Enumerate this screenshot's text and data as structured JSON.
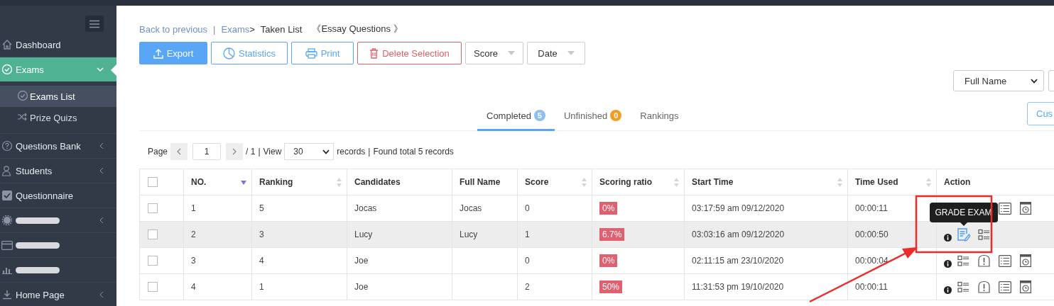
{
  "sidebar": {
    "items": [
      {
        "kind": "home",
        "label": "Dashboard",
        "redacted": false,
        "selected": false,
        "submenu": false
      },
      {
        "kind": "check",
        "label": "Exams",
        "redacted": false,
        "selected": true,
        "submenu": true,
        "expanded": true,
        "children": [
          {
            "kind": "check",
            "label": "Exams List",
            "selected": true
          },
          {
            "kind": "shuffle",
            "label": "Prize Quizs",
            "selected": false
          }
        ]
      },
      {
        "kind": "question",
        "label": "Questions Bank",
        "redacted": false,
        "selected": false,
        "submenu": true,
        "expanded": false
      },
      {
        "kind": "user",
        "label": "Students",
        "redacted": false,
        "selected": false,
        "submenu": true,
        "expanded": false
      },
      {
        "kind": "checkbox",
        "label": "Questionnaire",
        "redacted": false,
        "selected": false,
        "submenu": false
      },
      {
        "kind": "gear",
        "redacted": true,
        "selected": false,
        "submenu": true,
        "expanded": false
      },
      {
        "kind": "card",
        "redacted": true,
        "selected": false,
        "submenu": false
      },
      {
        "kind": "chart",
        "redacted": true,
        "selected": false,
        "submenu": false
      },
      {
        "kind": "download",
        "label": "Home Page",
        "redacted": false,
        "selected": false,
        "submenu": true,
        "expanded": false
      }
    ]
  },
  "breadcrumb": {
    "back": "Back to previous",
    "separator": "|",
    "parent": "Exams",
    "arrow": ">",
    "current": "Taken List",
    "subject": "《Essay Questions 》"
  },
  "toolbar": [
    {
      "kind": "export",
      "label": "Export"
    },
    {
      "kind": "statistics",
      "label": "Statistics"
    },
    {
      "kind": "print",
      "label": "Print"
    },
    {
      "kind": "delete",
      "label": "Delete Selection"
    },
    {
      "kind": "dropdown",
      "label": "Score"
    },
    {
      "kind": "dropdown",
      "label": "Date"
    }
  ],
  "search": {
    "field": "Full Name"
  },
  "tabs": [
    {
      "label": "Completed",
      "count": "5",
      "color": "#8cbff0",
      "selected": true
    },
    {
      "label": "Unfinished",
      "count": "0",
      "color": "#f39c1f",
      "selected": false
    },
    {
      "label": "Rankings",
      "selected": false
    }
  ],
  "custom_button": "Cus",
  "pagination": {
    "label": "Page",
    "page": "1",
    "total": "/ 1",
    "separator": "|",
    "view": "View",
    "per_page": "30",
    "records": "records",
    "separator_2": "|",
    "found": "Found total 5 records"
  },
  "table": {
    "select_all": false,
    "columns": [
      {
        "label": "NO.",
        "sortable": true,
        "sorted": true
      },
      {
        "label": "Ranking",
        "sortable": true,
        "sorted": false
      },
      {
        "label": "Candidates",
        "sortable": false
      },
      {
        "label": "Full Name",
        "sortable": false
      },
      {
        "label": "Score",
        "sortable": true,
        "sorted": false
      },
      {
        "label": "Scoring ratio",
        "sortable": true,
        "sorted": false
      },
      {
        "label": "Start Time",
        "sortable": true,
        "sorted": false
      },
      {
        "label": "Time Used",
        "sortable": true,
        "sorted": false
      },
      {
        "label": "Action"
      }
    ],
    "rows": [
      {
        "checked": false,
        "highlighted": false,
        "cells": [
          "1",
          "5",
          "Jocas",
          "Jocas",
          "0"
        ],
        "ratio": "0%",
        "start": "03:17:59 am 09/12/2020",
        "used": "00:00:11",
        "actions": [
          {
            "kind": "covered-info"
          },
          {
            "kind": "covered"
          },
          {
            "kind": "covered"
          },
          {
            "kind": "details",
            "active": false
          },
          {
            "kind": "clock-window",
            "active": false
          }
        ]
      },
      {
        "checked": false,
        "highlighted": true,
        "cells": [
          "2",
          "3",
          "Lucy",
          "Lucy",
          "1"
        ],
        "ratio": "6.7%",
        "start": "03:03:16 am 09/12/2020",
        "used": "00:00:50",
        "actions": [
          {
            "kind": "info"
          },
          {
            "kind": "grade",
            "active": true,
            "tooltip": "GRADE EXAM"
          },
          {
            "kind": "checklist",
            "active": false
          }
        ]
      },
      {
        "checked": false,
        "highlighted": false,
        "cells": [
          "3",
          "4",
          "Joe",
          "",
          "0"
        ],
        "ratio": "0%",
        "start": "02:11:15 am 23/10/2020",
        "used": "00:00:04",
        "actions": [
          {
            "kind": "info"
          },
          {
            "kind": "checklist",
            "active": false
          },
          {
            "kind": "alert",
            "active": false
          },
          {
            "kind": "details",
            "active": false
          },
          {
            "kind": "clock-window",
            "active": false
          }
        ]
      },
      {
        "checked": false,
        "highlighted": false,
        "cells": [
          "4",
          "1",
          "Joe",
          "",
          "2"
        ],
        "ratio": "50%",
        "start": "11:31:53 pm 19/10/2020",
        "used": "00:00:11",
        "actions": [
          {
            "kind": "info"
          },
          {
            "kind": "checklist",
            "active": false
          },
          {
            "kind": "alert",
            "active": false
          },
          {
            "kind": "details",
            "active": false
          },
          {
            "kind": "clock-window",
            "active": false
          }
        ]
      }
    ]
  }
}
